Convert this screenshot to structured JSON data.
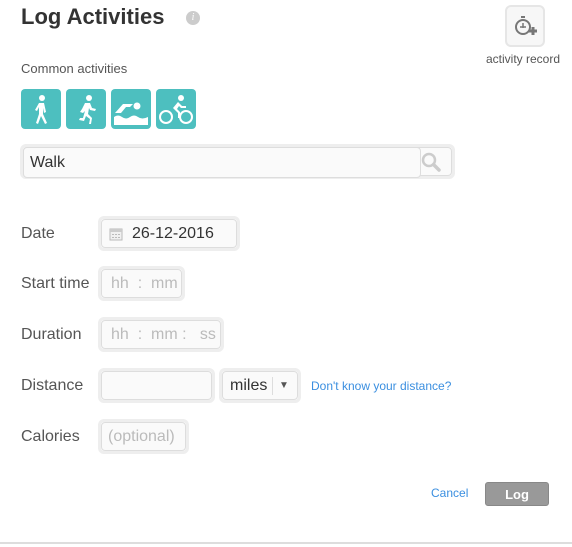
{
  "header": {
    "title": "Log Activities",
    "info_icon": "info-icon"
  },
  "activity_record": {
    "label": "activity record",
    "icon": "stopwatch-plus-icon"
  },
  "common": {
    "label": "Common activities",
    "items": [
      {
        "name": "walk",
        "icon": "walk-icon"
      },
      {
        "name": "run",
        "icon": "run-icon"
      },
      {
        "name": "swim",
        "icon": "swim-icon"
      },
      {
        "name": "bike",
        "icon": "bike-icon"
      }
    ],
    "color": "#4dbfbf"
  },
  "search": {
    "value": "Walk",
    "icon": "search-icon"
  },
  "form": {
    "date": {
      "label": "Date",
      "value": "26-12-2016"
    },
    "start_time": {
      "label": "Start time",
      "placeholder": "hh  :  mm"
    },
    "duration": {
      "label": "Duration",
      "placeholder": "hh  :  mm :   ss"
    },
    "distance": {
      "label": "Distance",
      "value": "",
      "unit": "miles",
      "help_link": "Don't know your distance?"
    },
    "calories": {
      "label": "Calories",
      "placeholder": "(optional)"
    }
  },
  "actions": {
    "cancel": "Cancel",
    "log": "Log"
  },
  "colors": {
    "link": "#3b8fe0",
    "log_button": "#999999"
  }
}
